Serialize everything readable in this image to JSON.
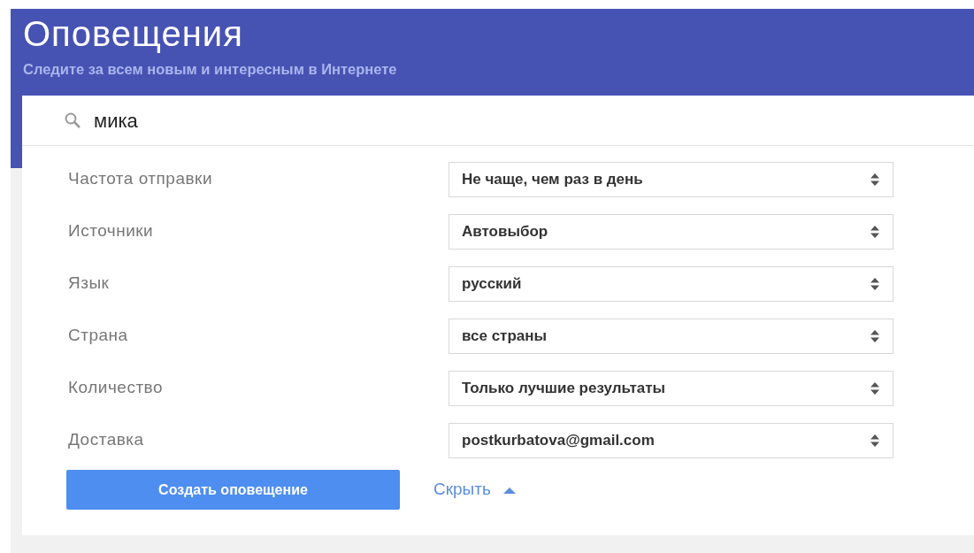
{
  "header": {
    "title": "Оповещения",
    "subtitle": "Следите за всем новым и интересным в Интернете"
  },
  "search": {
    "value": "мика"
  },
  "settings": [
    {
      "label": "Частота отправки",
      "value": "Не чаще, чем раз в день"
    },
    {
      "label": "Источники",
      "value": "Автовыбор"
    },
    {
      "label": "Язык",
      "value": "русский"
    },
    {
      "label": "Страна",
      "value": "все страны"
    },
    {
      "label": "Количество",
      "value": "Только лучшие результаты"
    },
    {
      "label": "Доставка",
      "value": "postkurbatova@gmail.com"
    }
  ],
  "create_button": "Создать оповещение",
  "hide_link": "Скрыть"
}
